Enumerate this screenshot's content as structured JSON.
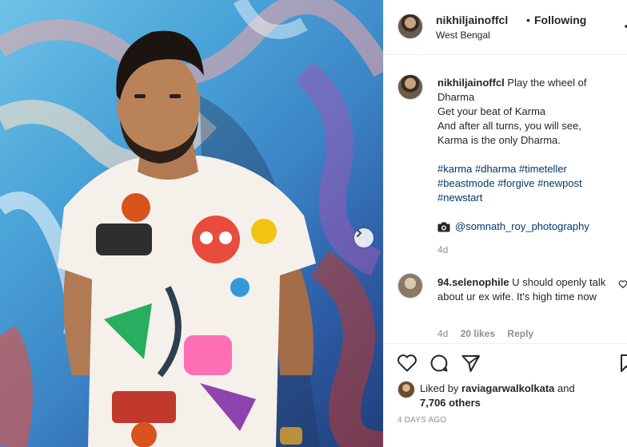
{
  "header": {
    "username": "nikhiljainoffcl",
    "separator": "•",
    "follow_status": "Following",
    "location": "West Bengal"
  },
  "caption": {
    "username": "nikhiljainoffcl",
    "lines": [
      "Play the wheel of Dharma",
      "Get your beat of Karma",
      "And after all turns, you will see,",
      "Karma is the only Dharma."
    ],
    "hashtags_line1": [
      "#karma",
      "#dharma",
      "#timeteller"
    ],
    "hashtags_line2": [
      "#beastmode",
      "#forgive",
      "#newpost"
    ],
    "hashtags_line3": [
      "#newstart"
    ],
    "credit": "@somnath_roy_photography",
    "time": "4d"
  },
  "comment": {
    "username": "94.selenophile",
    "text": "U should openly talk about ur ex wife. It's high time now",
    "time": "4d",
    "likes": "20 likes",
    "reply": "Reply"
  },
  "likes": {
    "prefix": "Liked by",
    "user": "raviagarwalkolkata",
    "and": "and",
    "others": "7,706 others"
  },
  "post_date": "4 DAYS AGO",
  "icons": {
    "like": "heart-icon",
    "comment": "comment-icon",
    "share": "share-icon",
    "save": "bookmark-icon",
    "next": "chevron-right-icon",
    "camera": "camera-icon"
  },
  "colors": {
    "link": "#00376b",
    "muted": "#8e8e8e",
    "text": "#262626",
    "border": "#efefef"
  }
}
